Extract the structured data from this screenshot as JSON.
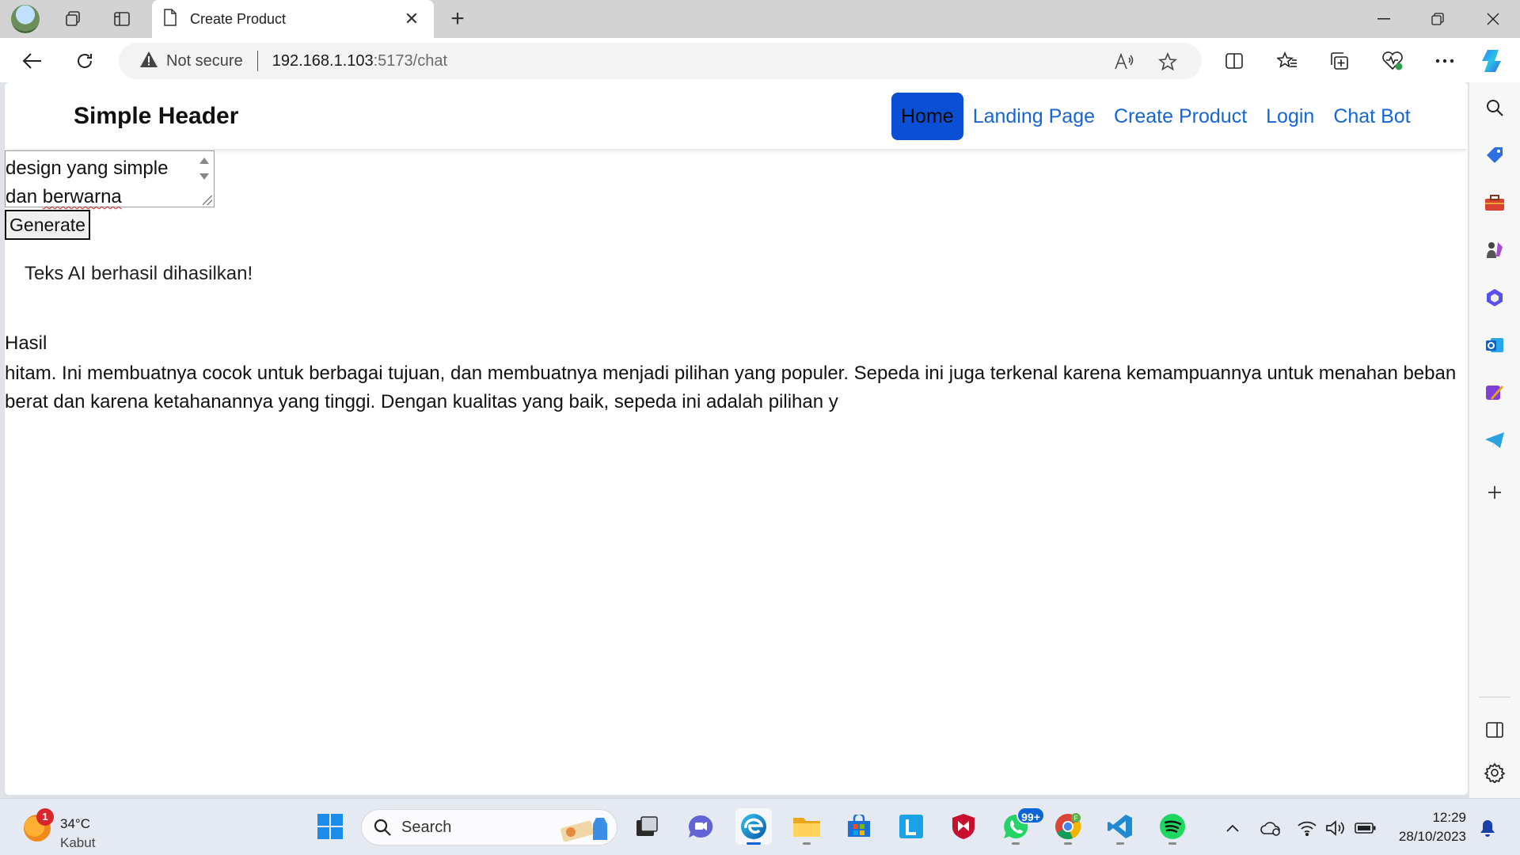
{
  "browser": {
    "tab_title": "Create Product",
    "security_label": "Not secure",
    "url_host": "192.168.1.103",
    "url_rest": ":5173/chat",
    "icons": [
      "profile-avatar",
      "workspaces-icon",
      "vertical-tabs-icon",
      "page-icon",
      "close-icon",
      "new-tab-icon",
      "minimize-icon",
      "restore-icon",
      "close-window-icon",
      "back-icon",
      "reload-icon",
      "warning-icon",
      "read-aloud-icon",
      "favorite-star-icon",
      "split-screen-icon",
      "favorites-icon",
      "collections-icon",
      "browser-essentials-icon",
      "more-icon",
      "copilot-icon"
    ]
  },
  "app": {
    "brand": "Simple Header",
    "nav": [
      {
        "label": "Home",
        "active": true
      },
      {
        "label": "Landing Page",
        "active": false
      },
      {
        "label": "Create Product",
        "active": false
      },
      {
        "label": "Login",
        "active": false
      },
      {
        "label": "Chat Bot",
        "active": false
      }
    ],
    "prompt_line1": "design yang simple",
    "prompt_line2_a": "dan ",
    "prompt_line2_b": "berwarna",
    "generate_label": "Generate",
    "success_message": "Teks AI berhasil dihasilkan!",
    "result_label": "Hasil",
    "result_text": "hitam. Ini membuatnya cocok untuk berbagai tujuan, dan membuatnya menjadi pilihan yang populer. Sepeda ini juga terkenal karena kemampuannya untuk menahan beban berat dan karena ketahanannya yang tinggi. Dengan kualitas yang baik, sepeda ini adalah pilihan y"
  },
  "sidebar": {
    "icons": [
      "search-icon",
      "shopping-tag-icon",
      "tools-icon",
      "games-icon",
      "microsoft365-icon",
      "outlook-icon",
      "designer-icon",
      "telegram-icon",
      "add-icon",
      "sidebar-toggle-icon",
      "settings-icon"
    ]
  },
  "taskbar": {
    "weather_badge": "1",
    "weather_temp": "34°C",
    "weather_desc": "Kabut",
    "search_label": "Search",
    "whatsapp_badge": "99+",
    "clock_time": "12:29",
    "clock_date": "28/10/2023",
    "colors": {
      "accent": "#0b64d8",
      "active_nav": "#0b50d4",
      "link": "#1565d8"
    }
  }
}
